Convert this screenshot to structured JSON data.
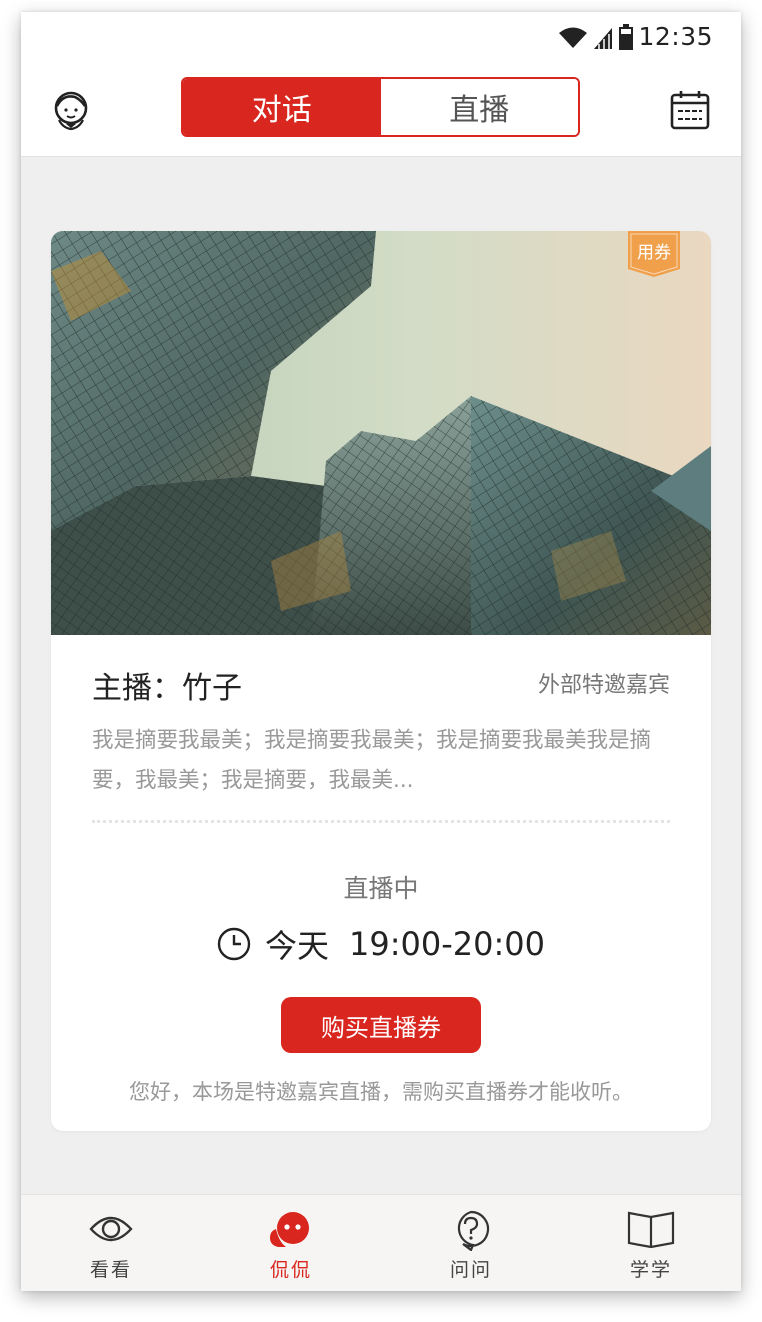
{
  "status_bar": {
    "time": "12:35"
  },
  "header": {
    "tabs": [
      {
        "label": "对话",
        "active": true
      },
      {
        "label": "直播",
        "active": false
      }
    ],
    "left_icon": "support-agent-icon",
    "right_icon": "calendar-icon"
  },
  "card": {
    "coupon_tag": "用券",
    "host": "主播：竹子",
    "guest_type": "外部特邀嘉宾",
    "summary": "我是摘要我最美；我是摘要我最美；我是摘要我最美我是摘要，我最美；我是摘要，我最美...",
    "live_status": "直播中",
    "time_day": "今天",
    "time_range": "19:00-20:00",
    "buy_button": "购买直播券",
    "notice": "您好，本场是特邀嘉宾直播，需购买直播券才能收听。"
  },
  "bottom_nav": [
    {
      "label": "看看",
      "icon": "eye-icon",
      "active": false
    },
    {
      "label": "侃侃",
      "icon": "chat-bubbles-icon",
      "active": true
    },
    {
      "label": "问问",
      "icon": "question-bubble-icon",
      "active": false
    },
    {
      "label": "学学",
      "icon": "book-icon",
      "active": false
    }
  ],
  "colors": {
    "accent": "#d9261f",
    "tag": "#f0a04b",
    "background": "#efefef"
  }
}
